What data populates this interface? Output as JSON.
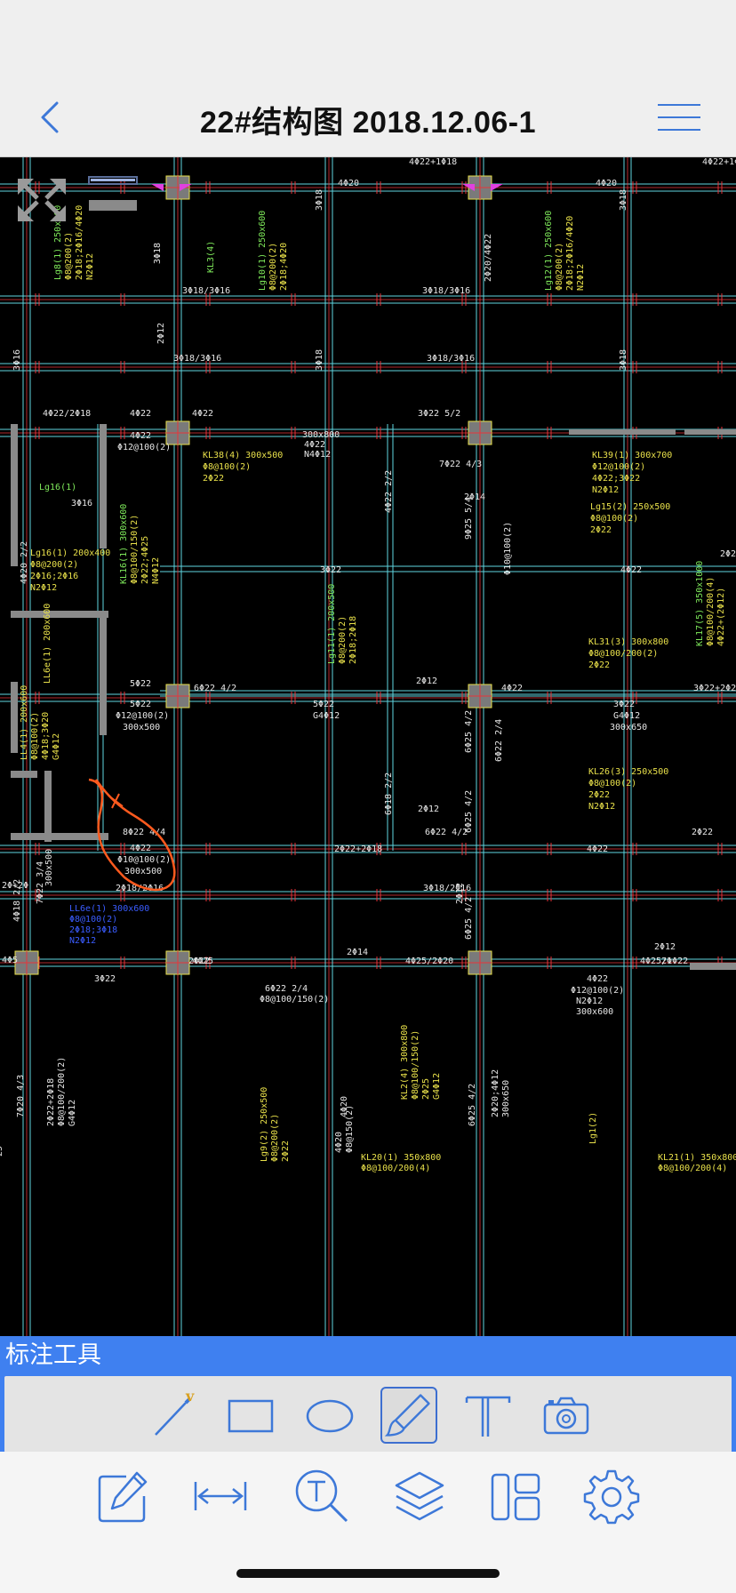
{
  "header": {
    "title": "22#结构图 2018.12.06-1",
    "back_icon": "chevron-left-icon",
    "menu_icon": "hamburger-menu-icon"
  },
  "drawing": {
    "labels": [
      {
        "t": "4Φ22+1Φ18"
      },
      {
        "t": "4Φ22+1Φ"
      },
      {
        "t": "4Φ20"
      },
      {
        "t": "4Φ20"
      },
      {
        "t": "Lg8(1) 250x600"
      },
      {
        "t": "Φ8@200(2)"
      },
      {
        "t": "2Φ18;2Φ16/4Φ20"
      },
      {
        "t": "N2Φ12"
      },
      {
        "t": "KL3(4)"
      },
      {
        "t": "Lg10(1) 250x600"
      },
      {
        "t": "Φ8@200(2)"
      },
      {
        "t": "2Φ18;4Φ20"
      },
      {
        "t": "Lg12(1) 250x600"
      },
      {
        "t": "Φ8@200(2)"
      },
      {
        "t": "2Φ18;2Φ16/4Φ20"
      },
      {
        "t": "N2Φ12"
      },
      {
        "t": "3Φ18/3Φ16"
      },
      {
        "t": "3Φ18/3Φ16"
      },
      {
        "t": "3Φ18/3Φ16"
      },
      {
        "t": "3Φ18/3Φ16"
      },
      {
        "t": "4Φ22/2Φ18"
      },
      {
        "t": "4Φ22"
      },
      {
        "t": "4Φ22"
      },
      {
        "t": "3Φ22 5/2"
      },
      {
        "t": "300x800"
      },
      {
        "t": "4Φ22"
      },
      {
        "t": "N4Φ12"
      },
      {
        "t": "4Φ22"
      },
      {
        "t": "Φ12@100(2)"
      },
      {
        "t": "KL38(4) 300x500"
      },
      {
        "t": "Φ8@100(2)"
      },
      {
        "t": "2Φ22"
      },
      {
        "t": "KL39(1) 300x700"
      },
      {
        "t": "Φ12@100(2)"
      },
      {
        "t": "4Φ22;3Φ22"
      },
      {
        "t": "N2Φ12"
      },
      {
        "t": "Lg15(2) 250x500"
      },
      {
        "t": "Φ8@100(2)"
      },
      {
        "t": "2Φ22"
      },
      {
        "t": "Lg16(1)"
      },
      {
        "t": "Lg16(1) 200x400"
      },
      {
        "t": "Φ8@200(2)"
      },
      {
        "t": "2Φ16;2Φ16"
      },
      {
        "t": "N2Φ12"
      },
      {
        "t": "KL16(1) 300x600"
      },
      {
        "t": "Φ8@100/150(2)"
      },
      {
        "t": "2Φ22;4Φ25"
      },
      {
        "t": "N4Φ12"
      },
      {
        "t": "3Φ22"
      },
      {
        "t": "4Φ22"
      },
      {
        "t": "2Φ22"
      },
      {
        "t": "Lg11(1) 200x500"
      },
      {
        "t": "Φ8@200(2)"
      },
      {
        "t": "2Φ18;2Φ18"
      },
      {
        "t": "KL31(3) 300x800"
      },
      {
        "t": "Φ8@100/200(2)"
      },
      {
        "t": "2Φ22"
      },
      {
        "t": "KL17(5) 350x1000"
      },
      {
        "t": "Φ8@100/200(4)"
      },
      {
        "t": "4Φ22+(2Φ12)"
      },
      {
        "t": "5Φ22"
      },
      {
        "t": "6Φ22 4/2"
      },
      {
        "t": "2Φ12"
      },
      {
        "t": "4Φ22"
      },
      {
        "t": "3Φ22+2Φ20"
      },
      {
        "t": "5Φ22"
      },
      {
        "t": "Φ12@100(2)"
      },
      {
        "t": "300x500"
      },
      {
        "t": "5Φ22"
      },
      {
        "t": "G4Φ12"
      },
      {
        "t": "3Φ22"
      },
      {
        "t": "G4Φ12"
      },
      {
        "t": "300x650"
      },
      {
        "t": "KL26(3) 250x500"
      },
      {
        "t": "Φ8@100(2)"
      },
      {
        "t": "2Φ22"
      },
      {
        "t": "N2Φ12"
      },
      {
        "t": "LL4(1) 200x600"
      },
      {
        "t": "Φ8@100(2)"
      },
      {
        "t": "4Φ18;3Φ20"
      },
      {
        "t": "G4Φ12"
      },
      {
        "t": "LL6e(1) 200x600"
      },
      {
        "t": "8Φ22 4/4"
      },
      {
        "t": "6Φ22 4/2"
      },
      {
        "t": "2Φ12"
      },
      {
        "t": "2Φ22"
      },
      {
        "t": "4Φ22"
      },
      {
        "t": "Φ10@100(2)"
      },
      {
        "t": "300x500"
      },
      {
        "t": "2Φ22+2Φ18"
      },
      {
        "t": "4Φ22"
      },
      {
        "t": "2Φ18/2Φ16"
      },
      {
        "t": "3Φ18/2Φ16"
      },
      {
        "t": "LL6e(1) 300x600"
      },
      {
        "t": "Φ8@100(2)"
      },
      {
        "t": "2Φ18;3Φ18"
      },
      {
        "t": "N2Φ12"
      },
      {
        "t": "2Φ14"
      },
      {
        "t": "4Φ25"
      },
      {
        "t": "4Φ25/2Φ20"
      },
      {
        "t": "2Φ12"
      },
      {
        "t": "4Φ25/1Φ22"
      },
      {
        "t": "3Φ22"
      },
      {
        "t": "6Φ22 2/4"
      },
      {
        "t": "Φ8@100/150(2)"
      },
      {
        "t": "4Φ22"
      },
      {
        "t": "Φ12@100(2)"
      },
      {
        "t": "N2Φ12"
      },
      {
        "t": "300x600"
      },
      {
        "t": "KL2(4) 300x800"
      },
      {
        "t": "Φ8@100/150(2)"
      },
      {
        "t": "2Φ25"
      },
      {
        "t": "G4Φ12"
      },
      {
        "t": "Lg9(2) 250x500"
      },
      {
        "t": "Φ8@200(2)"
      },
      {
        "t": "2Φ22"
      },
      {
        "t": "Lg1(2)"
      },
      {
        "t": "2Φ20;4Φ12"
      },
      {
        "t": "300x650"
      },
      {
        "t": "4Φ20"
      },
      {
        "t": "Φ8@150(2)"
      },
      {
        "t": "KL20(1) 350x800"
      },
      {
        "t": "Φ8@100/200(4)"
      },
      {
        "t": "KL21(1) 350x800"
      },
      {
        "t": "Φ8@100/200(4)"
      },
      {
        "t": "2Φ22+2Φ18"
      },
      {
        "t": "Φ8@100/200(2)"
      },
      {
        "t": "G4Φ12"
      },
      {
        "t": "6Φ25 4/2"
      },
      {
        "t": "6Φ25 4/2"
      },
      {
        "t": "6Φ25 4/2"
      },
      {
        "t": "6Φ25 4/2"
      },
      {
        "t": "6Φ18 2/2"
      },
      {
        "t": "9Φ25 5/4"
      },
      {
        "t": "7Φ22 4/3"
      },
      {
        "t": "2Φ14"
      },
      {
        "t": "2Φ12"
      },
      {
        "t": "6Φ22 2/4"
      },
      {
        "t": "Φ10@100(2)"
      },
      {
        "t": "3Φ16"
      },
      {
        "t": "4Φ20 2/2"
      },
      {
        "t": "2Φ20/4Φ22"
      },
      {
        "t": "4Φ22 2/2"
      },
      {
        "t": "7Φ22 3/4"
      },
      {
        "t": "300x500"
      },
      {
        "t": "4Φ18 2/2"
      },
      {
        "t": "7Φ20 4/3"
      },
      {
        "t": "4Φ20"
      },
      {
        "t": "3Φ16"
      },
      {
        "t": "3Φ18"
      },
      {
        "t": "3Φ18"
      },
      {
        "t": "3Φ18"
      },
      {
        "t": "3Φ18"
      },
      {
        "t": "3Φ18"
      },
      {
        "t": "2Φ12"
      },
      {
        "t": "2Φ12"
      },
      {
        "t": "4Φ5"
      },
      {
        "t": "25"
      },
      {
        "t": "2Φ"
      },
      {
        "t": "2Φ+2Φ"
      },
      {
        "t": "R"
      }
    ]
  },
  "annotation_toolbar": {
    "title": "标注工具",
    "tools": [
      {
        "name": "line-tool",
        "icon": "pen-line-icon"
      },
      {
        "name": "rectangle-tool",
        "icon": "rectangle-icon"
      },
      {
        "name": "ellipse-tool",
        "icon": "ellipse-icon"
      },
      {
        "name": "freehand-tool",
        "icon": "brush-icon",
        "selected": true
      },
      {
        "name": "text-tool",
        "icon": "text-t-icon"
      },
      {
        "name": "camera-tool",
        "icon": "camera-icon"
      }
    ]
  },
  "bottom_tabs": [
    {
      "name": "edit",
      "icon": "edit-pencil-icon"
    },
    {
      "name": "measure",
      "icon": "measure-arrows-icon"
    },
    {
      "name": "text-search",
      "icon": "text-search-icon"
    },
    {
      "name": "layers",
      "icon": "layers-icon"
    },
    {
      "name": "layout",
      "icon": "layout-panels-icon"
    },
    {
      "name": "settings",
      "icon": "gear-icon"
    }
  ],
  "colors": {
    "accent": "#3f80f0",
    "icon_blue": "#3d78d8",
    "cad_cyan": "#5fd6e0",
    "cad_red": "#e8343a",
    "cad_yellow": "#e8e04a",
    "cad_green": "#7ee85a",
    "cad_magenta": "#e040e0",
    "markup_orange": "#ff5a1e"
  }
}
